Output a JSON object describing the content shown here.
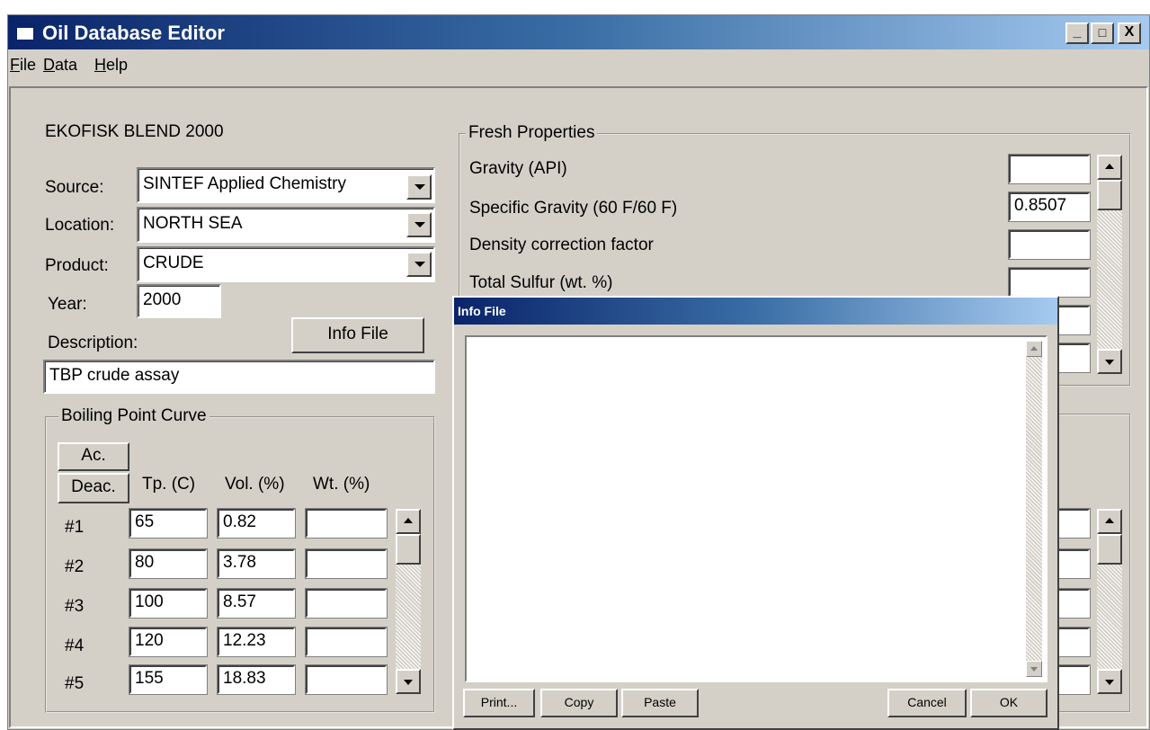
{
  "window": {
    "title": "Oil Database Editor",
    "controls": {
      "minimize": "_",
      "maximize": "□",
      "close": "X"
    }
  },
  "menu": [
    {
      "label": "File",
      "accel": "F",
      "rest": "ile"
    },
    {
      "label": "Data",
      "accel": "D",
      "rest": "ata"
    },
    {
      "label": "Help",
      "accel": "H",
      "rest": "elp"
    }
  ],
  "oil": {
    "name": "EKOFISK BLEND 2000",
    "source_label": "Source:",
    "source_value": "SINTEF Applied Chemistry",
    "location_label": "Location:",
    "location_value": "NORTH SEA",
    "product_label": "Product:",
    "product_value": "CRUDE",
    "year_label": "Year:",
    "year_value": "2000",
    "description_label": "Description:",
    "info_file_button": "Info File",
    "description_value": "TBP crude assay"
  },
  "boiling": {
    "title": "Boiling Point Curve",
    "ac_button": "Ac.",
    "deac_button": "Deac.",
    "headers": [
      "Tp. (C)",
      "Vol. (%)",
      "Wt. (%)"
    ],
    "rows": [
      {
        "label": "#1",
        "tp": "65",
        "vol": "0.82",
        "wt": ""
      },
      {
        "label": "#2",
        "tp": "80",
        "vol": "3.78",
        "wt": ""
      },
      {
        "label": "#3",
        "tp": "100",
        "vol": "8.57",
        "wt": ""
      },
      {
        "label": "#4",
        "tp": "120",
        "vol": "12.23",
        "wt": ""
      },
      {
        "label": "#5",
        "tp": "155",
        "vol": "18.83",
        "wt": ""
      }
    ]
  },
  "fresh": {
    "title": "Fresh Properties",
    "props": [
      {
        "label": "Gravity (API)",
        "value": ""
      },
      {
        "label": "Specific Gravity (60 F/60 F)",
        "value": "0.8507"
      },
      {
        "label": "Density correction factor",
        "value": ""
      },
      {
        "label": "Total Sulfur (wt. %)",
        "value": ""
      }
    ]
  },
  "dialog": {
    "title": "Info File",
    "text": "",
    "buttons": {
      "print": "Print...",
      "copy": "Copy",
      "paste": "Paste",
      "cancel": "Cancel",
      "ok": "OK"
    }
  }
}
